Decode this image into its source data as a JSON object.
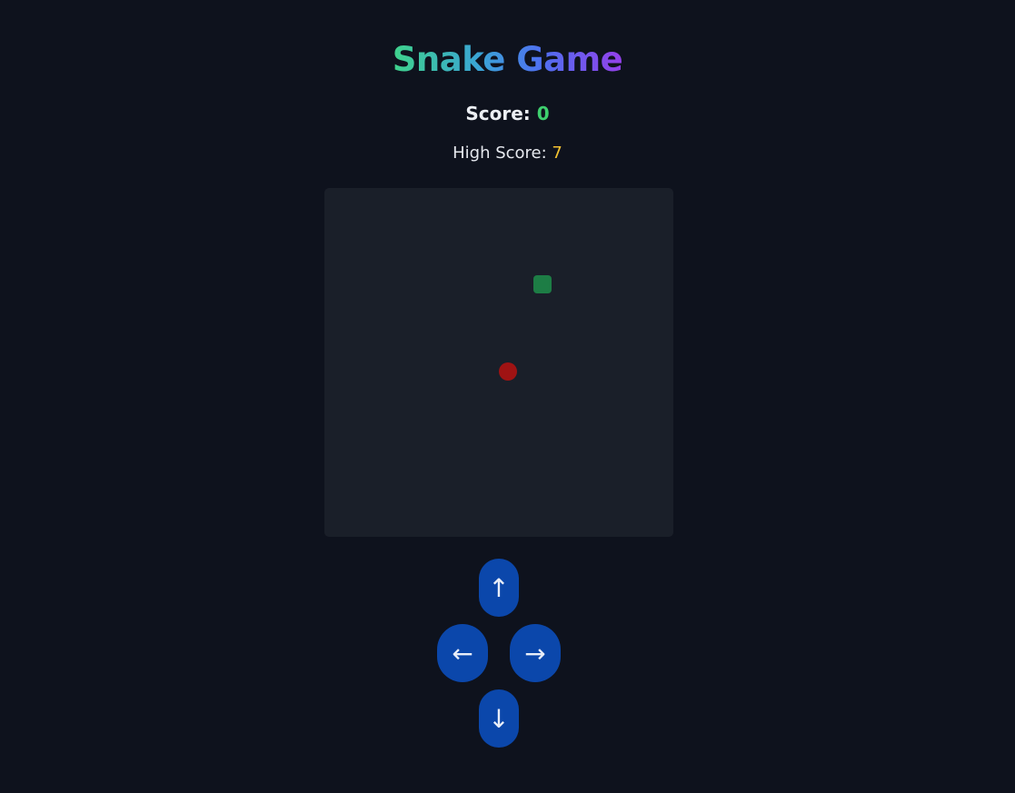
{
  "title": "Snake Game",
  "score": {
    "label": "Score:",
    "value": "0"
  },
  "high_score": {
    "label": "High Score:",
    "value": "7"
  },
  "colors": {
    "background": "#0e121d",
    "board": "#1a1f29",
    "snake": "#1d7d45",
    "food": "#a01313",
    "control": "#0b47ab",
    "score_value": "#3ecf6e",
    "high_score_value": "#f4c331"
  },
  "board": {
    "grid_columns": 20,
    "grid_rows": 20,
    "snake": [
      {
        "col": 12,
        "row": 5
      }
    ],
    "food": {
      "col": 10,
      "row": 10
    }
  },
  "controls": {
    "up": "↑",
    "left": "←",
    "right": "→",
    "down": "↓"
  }
}
